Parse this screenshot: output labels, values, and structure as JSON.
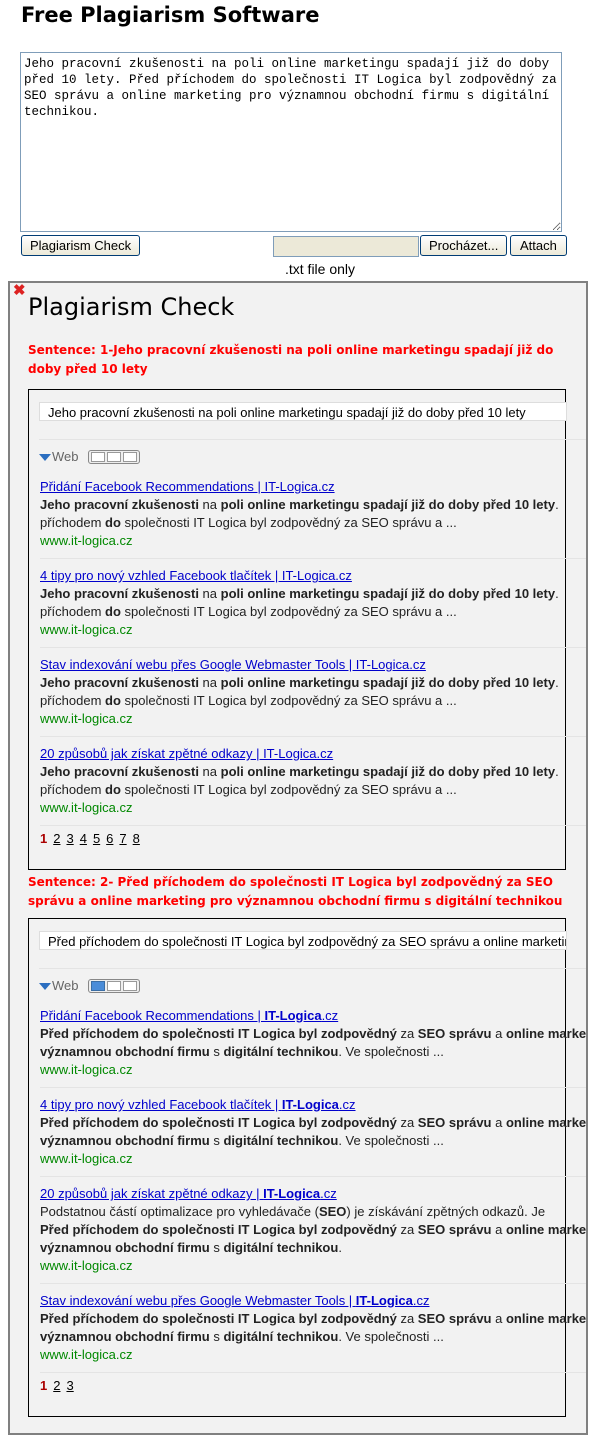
{
  "header": {
    "title": "Free Plagiarism Software"
  },
  "input": {
    "text": "Jeho pracovní zkušenosti na poli online marketingu spadají již do doby před 10 lety. Před příchodem do společnosti IT Logica byl zodpovědný za SEO správu a online marketing pro významnou obchodní firmu s digitální technikou."
  },
  "toolbar": {
    "check_label": "Plagiarism Check",
    "browse_label": "Procházet...",
    "attach_label": "Attach",
    "hint": ".txt file only"
  },
  "panel": {
    "title": "Plagiarism Check",
    "close_icon": "close-x-icon",
    "accent": "#ff0000",
    "sections": [
      {
        "sentence": "Sentence: 1-Jeho pracovní zkušenosti na poli online marketingu spadají již do doby před 10 lety",
        "query": "Jeho pracovní zkušenosti na poli online marketingu spadají již do doby před 10 lety",
        "web_label": "Web",
        "active_view": 0,
        "results": [
          {
            "title": [
              {
                "t": "Přidání Facebook Recommendations | IT-Logica.cz"
              }
            ],
            "lines": [
              [
                {
                  "t": "Jeho pracovní zkušenosti",
                  "b": 1
                },
                {
                  "t": " na "
                },
                {
                  "t": "poli online marketingu spadají již do doby před 10 lety",
                  "b": 1
                },
                {
                  "t": "."
                }
              ],
              [
                {
                  "t": "příchodem "
                },
                {
                  "t": "do",
                  "b": 1
                },
                {
                  "t": " společnosti IT Logica byl zodpovědný za SEO správu a ..."
                }
              ]
            ],
            "url": "www.it-logica.cz"
          },
          {
            "title": [
              {
                "t": "4 tipy pro nový vzhled Facebook tlačítek | IT-Logica.cz"
              }
            ],
            "lines": [
              [
                {
                  "t": "Jeho pracovní zkušenosti",
                  "b": 1
                },
                {
                  "t": " na "
                },
                {
                  "t": "poli online marketingu spadají již do doby před 10 lety",
                  "b": 1
                },
                {
                  "t": "."
                }
              ],
              [
                {
                  "t": "příchodem "
                },
                {
                  "t": "do",
                  "b": 1
                },
                {
                  "t": " společnosti IT Logica byl zodpovědný za SEO správu a ..."
                }
              ]
            ],
            "url": "www.it-logica.cz"
          },
          {
            "title": [
              {
                "t": "Stav indexování webu přes Google Webmaster Tools | IT-Logica.cz"
              }
            ],
            "lines": [
              [
                {
                  "t": "Jeho pracovní zkušenosti",
                  "b": 1
                },
                {
                  "t": " na "
                },
                {
                  "t": "poli online marketingu spadají již do doby před 10 lety",
                  "b": 1
                },
                {
                  "t": "."
                }
              ],
              [
                {
                  "t": "příchodem "
                },
                {
                  "t": "do",
                  "b": 1
                },
                {
                  "t": " společnosti IT Logica byl zodpovědný za SEO správu a ..."
                }
              ]
            ],
            "url": "www.it-logica.cz"
          },
          {
            "title": [
              {
                "t": "20 způsobů jak získat zpětné odkazy | IT-Logica.cz"
              }
            ],
            "lines": [
              [
                {
                  "t": "Jeho pracovní zkušenosti",
                  "b": 1
                },
                {
                  "t": " na "
                },
                {
                  "t": "poli online marketingu spadají již do doby před 10 lety",
                  "b": 1
                },
                {
                  "t": "."
                }
              ],
              [
                {
                  "t": "příchodem "
                },
                {
                  "t": "do",
                  "b": 1
                },
                {
                  "t": " společnosti IT Logica byl zodpovědný za SEO správu a ..."
                }
              ]
            ],
            "url": "www.it-logica.cz"
          }
        ],
        "pages": [
          "1",
          "2",
          "3",
          "4",
          "5",
          "6",
          "7",
          "8"
        ],
        "current_page": "1"
      },
      {
        "sentence": "Sentence: 2- Před příchodem do společnosti IT Logica byl zodpovědný za SEO správu a online marketing pro významnou obchodní firmu s digitální technikou",
        "query": "Před příchodem do společnosti IT Logica byl zodpovědný za SEO správu a online marketing pro významnou obchodní firmu s digitální technikou",
        "web_label": "Web",
        "active_view": 0,
        "results": [
          {
            "title": [
              {
                "t": "Přidání Facebook Recommendations | "
              },
              {
                "t": "IT-Logica",
                "b": 1
              },
              {
                "t": ".cz"
              }
            ],
            "lines": [
              [
                {
                  "t": "Před příchodem do společnosti IT Logica byl zodpovědný",
                  "b": 1
                },
                {
                  "t": " za "
                },
                {
                  "t": "SEO správu",
                  "b": 1
                },
                {
                  "t": " a "
                },
                {
                  "t": "online marketing",
                  "b": 1
                }
              ],
              [
                {
                  "t": "významnou obchodní firmu",
                  "b": 1
                },
                {
                  "t": " s "
                },
                {
                  "t": "digitální technikou",
                  "b": 1
                },
                {
                  "t": ". Ve společnosti ..."
                }
              ]
            ],
            "url": "www.it-logica.cz"
          },
          {
            "title": [
              {
                "t": "4 tipy pro nový vzhled Facebook tlačítek | "
              },
              {
                "t": "IT-Logica",
                "b": 1
              },
              {
                "t": ".cz"
              }
            ],
            "lines": [
              [
                {
                  "t": "Před příchodem do společnosti IT Logica byl zodpovědný",
                  "b": 1
                },
                {
                  "t": " za "
                },
                {
                  "t": "SEO správu",
                  "b": 1
                },
                {
                  "t": " a "
                },
                {
                  "t": "online marketing",
                  "b": 1
                }
              ],
              [
                {
                  "t": "významnou obchodní firmu",
                  "b": 1
                },
                {
                  "t": " s "
                },
                {
                  "t": "digitální technikou",
                  "b": 1
                },
                {
                  "t": ". Ve společnosti ..."
                }
              ]
            ],
            "url": "www.it-logica.cz"
          },
          {
            "title": [
              {
                "t": "20 způsobů jak získat zpětné odkazy | "
              },
              {
                "t": "IT-Logica",
                "b": 1
              },
              {
                "t": ".cz"
              }
            ],
            "lines": [
              [
                {
                  "t": "Podstatnou částí optimalizace pro vyhledávače ("
                },
                {
                  "t": "SEO",
                  "b": 1
                },
                {
                  "t": ") je získávání zpětných odkazů. Je"
                }
              ],
              [
                {
                  "t": "Před příchodem do společnosti IT Logica byl zodpovědný",
                  "b": 1
                },
                {
                  "t": " za "
                },
                {
                  "t": "SEO správu",
                  "b": 1
                },
                {
                  "t": " a "
                },
                {
                  "t": "online marketing",
                  "b": 1
                }
              ],
              [
                {
                  "t": "významnou obchodní firmu",
                  "b": 1
                },
                {
                  "t": " s "
                },
                {
                  "t": "digitální technikou",
                  "b": 1
                },
                {
                  "t": "."
                }
              ]
            ],
            "url": "www.it-logica.cz"
          },
          {
            "title": [
              {
                "t": "Stav indexování webu přes Google Webmaster Tools | "
              },
              {
                "t": "IT-Logica",
                "b": 1
              },
              {
                "t": ".cz"
              }
            ],
            "lines": [
              [
                {
                  "t": "Před příchodem do společnosti IT Logica byl zodpovědný",
                  "b": 1
                },
                {
                  "t": " za "
                },
                {
                  "t": "SEO správu",
                  "b": 1
                },
                {
                  "t": " a "
                },
                {
                  "t": "online marketing",
                  "b": 1
                }
              ],
              [
                {
                  "t": "významnou obchodní firmu",
                  "b": 1
                },
                {
                  "t": " s "
                },
                {
                  "t": "digitální technikou",
                  "b": 1
                },
                {
                  "t": ". Ve společnosti ..."
                }
              ]
            ],
            "url": "www.it-logica.cz"
          }
        ],
        "pages": [
          "1",
          "2",
          "3"
        ],
        "current_page": "1"
      }
    ]
  }
}
